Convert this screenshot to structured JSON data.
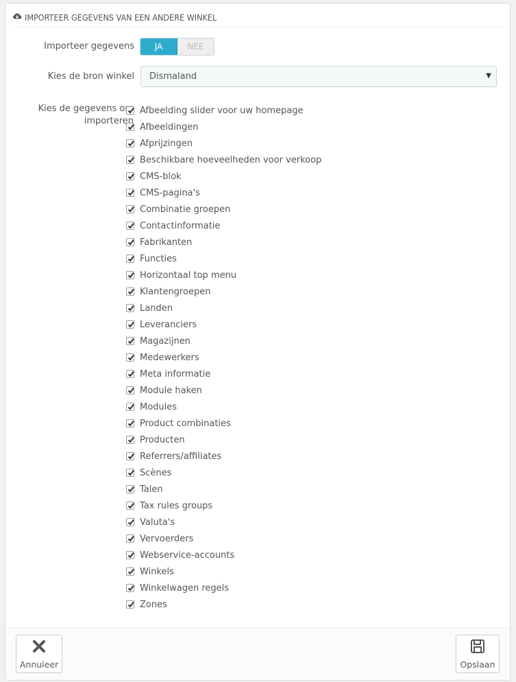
{
  "panel": {
    "title": "IMPORTEER GEGEVENS VAN EEN ANDERE WINKEL",
    "title_icon": "cloud-download-icon"
  },
  "form": {
    "import_label": "Importeer gegevens",
    "switch_yes": "JA",
    "switch_no": "NEE",
    "switch_selected": "JA",
    "source_label": "Kies de bron winkel",
    "source_value": "Dismaland",
    "data_label": "Kies de gegevens om importeren",
    "accent_color": "#2eacce"
  },
  "checklist": [
    {
      "label": "Afbeelding slider voor uw homepage",
      "checked": true
    },
    {
      "label": "Afbeeldingen",
      "checked": true
    },
    {
      "label": "Afprijzingen",
      "checked": true
    },
    {
      "label": "Beschikbare hoeveelheden voor verkoop",
      "checked": true
    },
    {
      "label": "CMS-blok",
      "checked": true
    },
    {
      "label": "CMS-pagina's",
      "checked": true
    },
    {
      "label": "Combinatie groepen",
      "checked": true
    },
    {
      "label": "Contactinformatie",
      "checked": true
    },
    {
      "label": "Fabrikanten",
      "checked": true
    },
    {
      "label": "Functies",
      "checked": true
    },
    {
      "label": "Horizontaal top menu",
      "checked": true
    },
    {
      "label": "Klantengroepen",
      "checked": true
    },
    {
      "label": "Landen",
      "checked": true
    },
    {
      "label": "Leveranciers",
      "checked": true
    },
    {
      "label": "Magazijnen",
      "checked": true
    },
    {
      "label": "Medewerkers",
      "checked": true
    },
    {
      "label": "Meta informatie",
      "checked": true
    },
    {
      "label": "Module haken",
      "checked": true
    },
    {
      "label": "Modules",
      "checked": true
    },
    {
      "label": "Product combinaties",
      "checked": true
    },
    {
      "label": "Producten",
      "checked": true
    },
    {
      "label": "Referrers/affiliates",
      "checked": true
    },
    {
      "label": "Scènes",
      "checked": true
    },
    {
      "label": "Talen",
      "checked": true
    },
    {
      "label": "Tax rules groups",
      "checked": true
    },
    {
      "label": "Valuta's",
      "checked": true
    },
    {
      "label": "Vervoerders",
      "checked": true
    },
    {
      "label": "Webservice-accounts",
      "checked": true
    },
    {
      "label": "Winkels",
      "checked": true
    },
    {
      "label": "Winkelwagen regels",
      "checked": true
    },
    {
      "label": "Zones",
      "checked": true
    }
  ],
  "footer": {
    "cancel_label": "Annuleer",
    "cancel_icon": "close-icon",
    "save_label": "Opslaan",
    "save_icon": "save-icon"
  }
}
